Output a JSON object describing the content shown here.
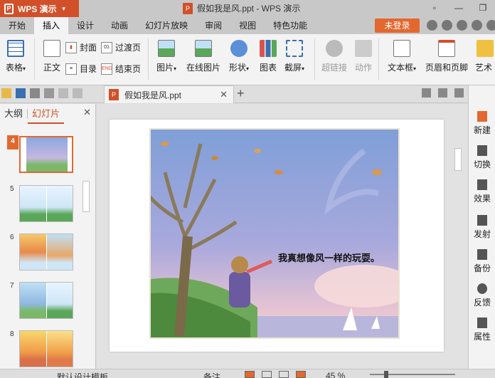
{
  "titlebar": {
    "app_name": "WPS 演示",
    "document_title": "假如我是风.ppt - WPS 演示",
    "ppt_icon_glyph": "P"
  },
  "menubar": {
    "tabs": [
      "开始",
      "插入",
      "设计",
      "动画",
      "幻灯片放映",
      "审阅",
      "视图",
      "特色功能"
    ],
    "active_tab": "插入",
    "login_label": "未登录"
  },
  "ribbon": {
    "table": "表格",
    "body": "正文",
    "cover": "封面",
    "toc": "目录",
    "transition_page": "过渡页",
    "end_page": "结束页",
    "picture": "图片",
    "online_picture": "在线图片",
    "shape": "形状",
    "chart": "图表",
    "screenshot": "截屏",
    "hyperlink": "超链接",
    "action": "动作",
    "textbox": "文本框",
    "header_footer": "页眉和页脚",
    "art_text": "艺术"
  },
  "docbar": {
    "tab_label": "假如我是风.ppt",
    "close_glyph": "✕",
    "new_tab_glyph": "+"
  },
  "leftpanel": {
    "tabs": [
      "大纲",
      "幻灯片"
    ],
    "active_tab": "幻灯片",
    "close_glyph": "✕",
    "thumbnails": [
      {
        "number": "4",
        "active": true
      },
      {
        "number": "5",
        "active": false
      },
      {
        "number": "6",
        "active": false
      },
      {
        "number": "7",
        "active": false
      },
      {
        "number": "8",
        "active": false
      }
    ]
  },
  "slide": {
    "text": "我真想像风一样的玩耍。"
  },
  "rightbar": {
    "items": [
      "新建",
      "切换",
      "效果",
      "发射",
      "备份",
      "反馈",
      "属性"
    ]
  },
  "statusbar": {
    "template": "默认设计模板",
    "notes": "备注",
    "zoom": "45 %"
  },
  "colors": {
    "accent": "#d1502a",
    "login_button": "#e2682f",
    "ribbon_bg": "#f3f3f3",
    "titlebar_bg": "#c8c8c8"
  }
}
